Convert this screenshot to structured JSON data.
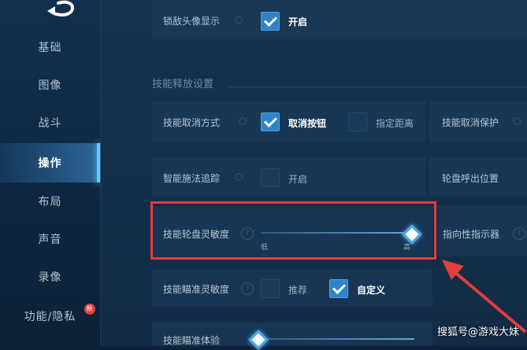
{
  "sidebar": {
    "items": [
      {
        "label": "基础"
      },
      {
        "label": "图像"
      },
      {
        "label": "战斗"
      },
      {
        "label": "操作"
      },
      {
        "label": "布局"
      },
      {
        "label": "声音"
      },
      {
        "label": "录像"
      },
      {
        "label": "功能/隐私"
      }
    ],
    "badge": "新"
  },
  "rows": {
    "lock_avatar": {
      "label": "锁敌头像显示",
      "option": "开启",
      "checked": true
    },
    "section_title": "技能释放设置",
    "cancel_method": {
      "label": "技能取消方式",
      "opt1": "取消按钮",
      "opt2": "指定距离",
      "right_label": "技能取消保护"
    },
    "smart_cast": {
      "label": "智能施法追踪",
      "option": "开启",
      "right_label": "轮盘呼出位置"
    },
    "wheel_sensitivity": {
      "label": "技能轮盘灵敏度",
      "low": "低",
      "high": "高",
      "value_fraction": 1.0,
      "right_label": "指向性指示器"
    },
    "aim_sensitivity": {
      "label": "技能瞄准灵敏度",
      "opt1": "推荐",
      "opt2": "自定义"
    },
    "aim_experience": {
      "label": "技能瞄准体验"
    }
  },
  "watermark": "搜狐号@游戏大妹",
  "colors": {
    "accent": "#2f83c6",
    "highlight": "#e33d3d"
  }
}
